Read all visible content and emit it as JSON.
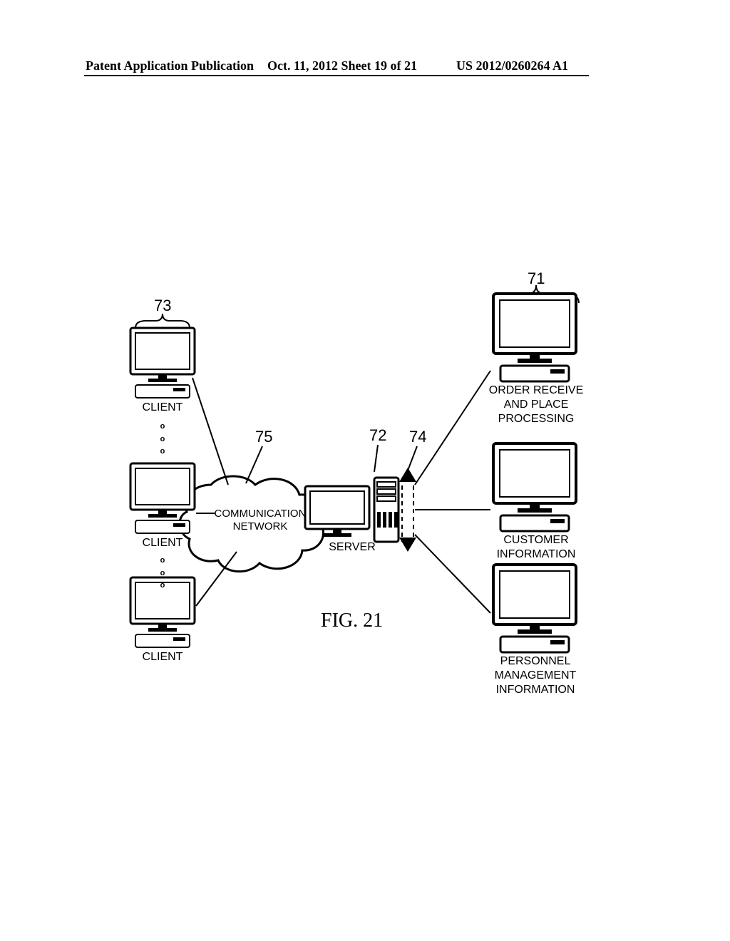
{
  "header": {
    "left": "Patent Application Publication",
    "mid": "Oct. 11, 2012   Sheet 19 of 21",
    "right": "US 2012/0260264 A1"
  },
  "refs": {
    "r71": "71",
    "r72": "72",
    "r73": "73",
    "r74": "74",
    "r75": "75"
  },
  "labels": {
    "client": "CLIENT",
    "server": "SERVER",
    "cloud": "COMMUNICATION\nNETWORK",
    "orderproc": "ORDER RECEIVE\nAND PLACE\nPROCESSING",
    "custinfo": "CUSTOMER\nINFORMATION",
    "personnel": "PERSONNEL\nMANAGEMENT\nINFORMATION"
  },
  "figcap": "FIG. 21",
  "ellipsis": "o\no\no"
}
